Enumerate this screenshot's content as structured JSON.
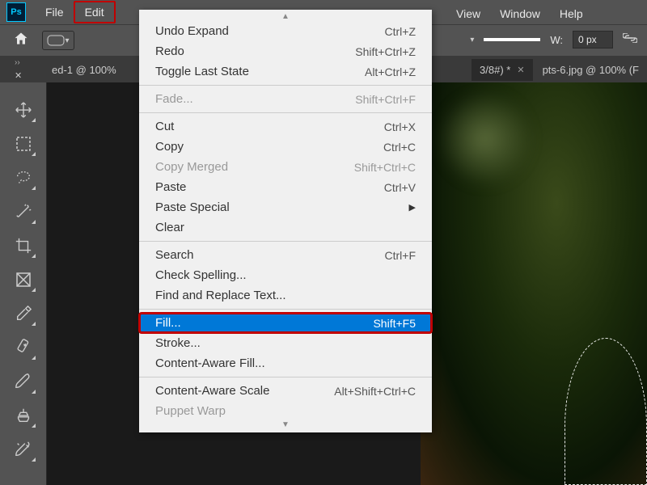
{
  "menubar": {
    "items": [
      "File",
      "Edit"
    ],
    "right_items": [
      "View",
      "Window",
      "Help"
    ]
  },
  "optbar": {
    "w_label": "W:",
    "w_value": "0 px"
  },
  "tabs": {
    "left": "ed-1 @ 100%",
    "mid": "3/8#) *",
    "right": "pts-6.jpg @ 100% (F"
  },
  "edit_menu": {
    "groups": [
      [
        {
          "label": "Undo Expand",
          "shortcut": "Ctrl+Z",
          "disabled": false
        },
        {
          "label": "Redo",
          "shortcut": "Shift+Ctrl+Z",
          "disabled": false
        },
        {
          "label": "Toggle Last State",
          "shortcut": "Alt+Ctrl+Z",
          "disabled": false
        }
      ],
      [
        {
          "label": "Fade...",
          "shortcut": "Shift+Ctrl+F",
          "disabled": true
        }
      ],
      [
        {
          "label": "Cut",
          "shortcut": "Ctrl+X",
          "disabled": false
        },
        {
          "label": "Copy",
          "shortcut": "Ctrl+C",
          "disabled": false
        },
        {
          "label": "Copy Merged",
          "shortcut": "Shift+Ctrl+C",
          "disabled": true
        },
        {
          "label": "Paste",
          "shortcut": "Ctrl+V",
          "disabled": false
        },
        {
          "label": "Paste Special",
          "shortcut": "",
          "disabled": false,
          "submenu": true
        },
        {
          "label": "Clear",
          "shortcut": "",
          "disabled": false
        }
      ],
      [
        {
          "label": "Search",
          "shortcut": "Ctrl+F",
          "disabled": false
        },
        {
          "label": "Check Spelling...",
          "shortcut": "",
          "disabled": false
        },
        {
          "label": "Find and Replace Text...",
          "shortcut": "",
          "disabled": false
        }
      ],
      [
        {
          "label": "Fill...",
          "shortcut": "Shift+F5",
          "disabled": false,
          "selected": true,
          "boxed": true
        },
        {
          "label": "Stroke...",
          "shortcut": "",
          "disabled": false
        },
        {
          "label": "Content-Aware Fill...",
          "shortcut": "",
          "disabled": false
        }
      ],
      [
        {
          "label": "Content-Aware Scale",
          "shortcut": "Alt+Shift+Ctrl+C",
          "disabled": false
        },
        {
          "label": "Puppet Warp",
          "shortcut": "",
          "disabled": true
        }
      ]
    ]
  }
}
